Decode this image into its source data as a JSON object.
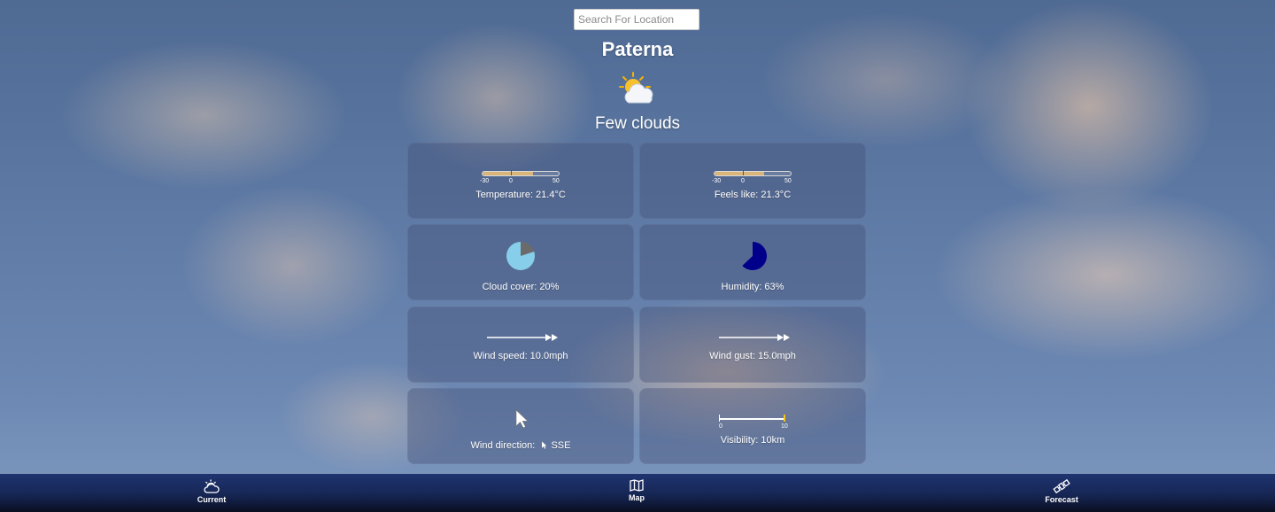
{
  "search": {
    "placeholder": "Search For Location",
    "value": ""
  },
  "location": {
    "city": "Paterna"
  },
  "weather": {
    "icon": "sun-behind-cloud-icon",
    "condition": "Few clouds"
  },
  "cards": {
    "temperature": {
      "label": "Temperature: 21.4°C",
      "value": 21.4,
      "min": -30,
      "max": 50,
      "tick_min": "-30",
      "tick_zero": "0",
      "tick_max": "50"
    },
    "feels_like": {
      "label": "Feels like: 21.3°C",
      "value": 21.3,
      "min": -30,
      "max": 50,
      "tick_min": "-30",
      "tick_zero": "0",
      "tick_max": "50"
    },
    "cloud_cover": {
      "label": "Cloud cover: 20%",
      "value": 20,
      "color": "#87ceeb"
    },
    "humidity": {
      "label": "Humidity: 63%",
      "value": 63,
      "color": "#00008b"
    },
    "wind_speed": {
      "label": "Wind speed: 10.0mph",
      "icon": "double-arrow-right-icon"
    },
    "wind_gust": {
      "label": "Wind gust: 15.0mph",
      "icon": "double-arrow-right-icon"
    },
    "wind_direction": {
      "label": "Wind direction:",
      "value": "SSE",
      "icon": "cursor-arrow-icon"
    },
    "visibility": {
      "label": "Visibility: 10km",
      "value": 10,
      "min": 0,
      "max": 10,
      "tick_min": "0",
      "tick_max": "10",
      "accent": "#f5c518"
    }
  },
  "nav": [
    {
      "label": "Current",
      "icon": "cloud-sun-icon"
    },
    {
      "label": "Map",
      "icon": "map-icon"
    },
    {
      "label": "Forecast",
      "icon": "satellite-icon"
    }
  ]
}
